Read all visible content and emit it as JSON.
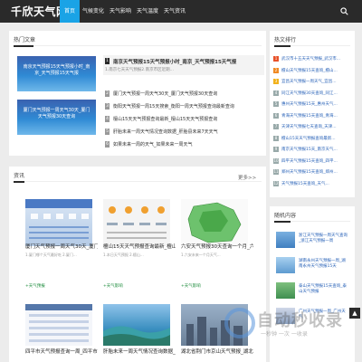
{
  "nav": {
    "logo": "千欣天气网",
    "items": [
      "首页",
      "气候变化",
      "天气影响",
      "天气温度",
      "天气资讯"
    ]
  },
  "hot": {
    "title": "热门文章",
    "thumbs": [
      "南京天气预报15天气预报小时_南京_天气预报15天气报",
      "厦门天气预报一周天气30天_厦门天气预报30天查询"
    ],
    "first": {
      "title": "南京天气预报15天气预报小时_南京_天气预报15天气报",
      "desc": "1.南京七天天气预报2.南京市区近期..."
    },
    "items": [
      "厦门天气预报一周天气30天_厦门天气预报30天查询",
      "衡阳天气预报一周15天搜索_衡阳一周天气预报查询最新查询",
      "檀山15天天气预报查询最新_檀山15天天气预报查询",
      "肝胎未来一周天气情况查询数据_肝胎县未来7天天气",
      "如果未来一周的天气_如果未来一周天气"
    ]
  },
  "news": {
    "title": "资讯",
    "more": "更多>>",
    "cards": [
      {
        "title": "厦门天气预报一周天气30天_厦门天气预报30天查询",
        "desc": "1.厦门哪个天气最好吃 2.厦门...",
        "tag": "+天气预报"
      },
      {
        "title": "檀山15天天气预报查询最新_檀山15天天气预报查询",
        "desc": "1.本日天气预报 2.檀山...",
        "tag": "+天气影响"
      },
      {
        "title": "六安天气预报30天查询一个月_六安天气预报30天",
        "desc": "1.六安未来一个月天气...",
        "tag": "+天气影响"
      },
      {
        "title": "四平市天气预报查询一周_四平市天气预报",
        "desc": "",
        "tag": ""
      },
      {
        "title": "肝胎未来一周天气情况查询数据_肝胎县",
        "desc": "",
        "tag": ""
      },
      {
        "title": "湖北省荆门市京山天气预报_湖北省荆门",
        "desc": "",
        "tag": ""
      }
    ]
  },
  "side_rank": {
    "title": "热文排行",
    "items": [
      "武汉市十五天天气预报_武汉市...",
      "檀山天气预报15天查询_檀山...",
      "宜昌天气预报一周天气_宜昌...",
      "同江天气预报30天查询_同江...",
      "惠州天气预报15天_惠州天气...",
      "青海天气预报15天查询_青海...",
      "天津天气预报七天查询_天津...",
      "檀山15天天气预报查询最新...",
      "南京天气预报15天_南京天气...",
      "四平天气预报15天查询_四平...",
      "郑州天气预报15天查询_郑州...",
      "天气预报15天查询_天气..."
    ]
  },
  "side_random": {
    "title": "随机内容",
    "items": [
      "浙江天气预报一周天气查询_浙江天气预报一周",
      "湖南永州天气预报一周_湖南永州天气预报15天",
      "泰山天气预报15天查询_泰山天气预报",
      "广州天气预报一周_广州天气"
    ]
  },
  "watermark": {
    "text": "自动秒收录",
    "sub": "一秒钟 一次 一收录"
  },
  "colors": {
    "nav_bg": "#2a2a2a",
    "accent": "#1aa3e6"
  }
}
